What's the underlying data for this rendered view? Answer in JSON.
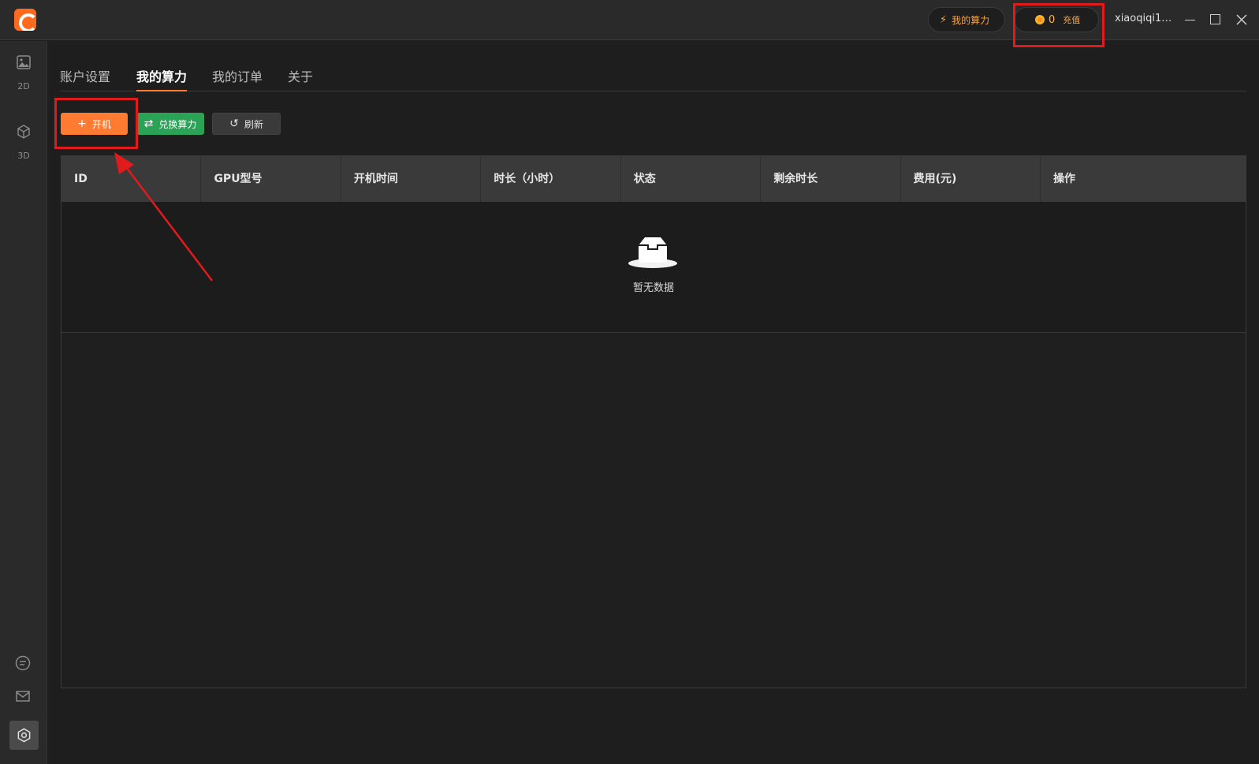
{
  "titlebar": {
    "power_label": "我的算力",
    "coin_count": "0",
    "recharge_label": "充值",
    "username": "xiaoqiqi1…"
  },
  "sidebar": {
    "items": [
      {
        "label": "2D",
        "icon": "image-icon"
      },
      {
        "label": "3D",
        "icon": "cube-icon"
      }
    ],
    "bottom_icons": [
      "chat-icon",
      "mail-icon",
      "settings-icon"
    ]
  },
  "tabs": [
    {
      "label": "账户设置",
      "active": false
    },
    {
      "label": "我的算力",
      "active": true
    },
    {
      "label": "我的订单",
      "active": false
    },
    {
      "label": "关于",
      "active": false
    }
  ],
  "toolbar": {
    "boot_label": "开机",
    "exchange_label": "兑换算力",
    "refresh_label": "刷新"
  },
  "table": {
    "columns": [
      "ID",
      "GPU型号",
      "开机时间",
      "时长（小时）",
      "状态",
      "剩余时长",
      "费用(元)",
      "操作"
    ],
    "rows": [],
    "empty_text": "暂无数据"
  },
  "colors": {
    "accent": "#ff7b32",
    "green": "#2aa357",
    "annotation": "#e01b1b"
  }
}
